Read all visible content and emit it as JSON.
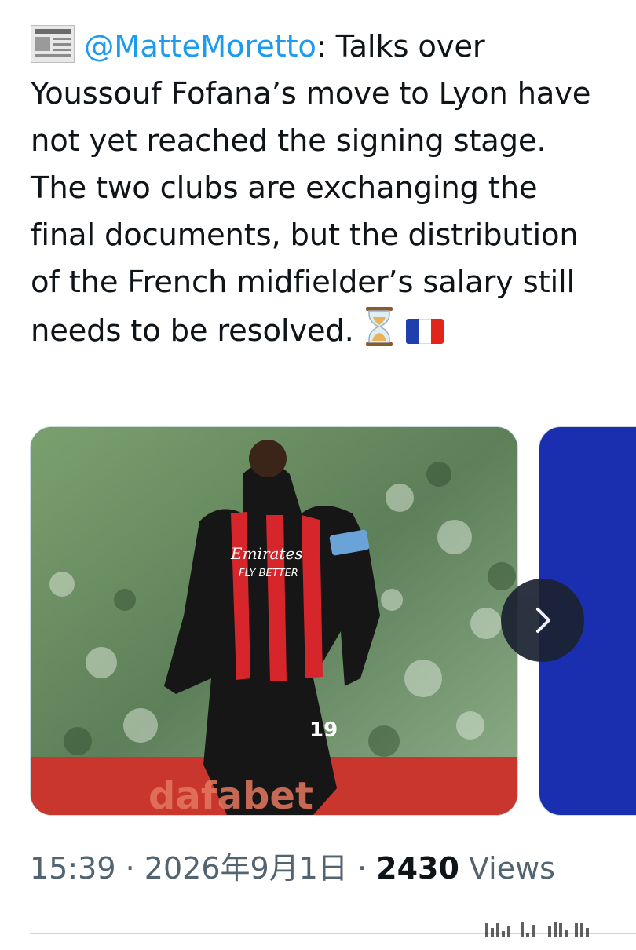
{
  "tweet": {
    "mention": "@MatteMoretto",
    "text_after_mention": ": Talks over Youssouf Fofana’s move to Lyon have not yet reached the signing stage. The two clubs are exchanging the final documents, but the distribution of the French midfielder’s salary still needs to be resolved.",
    "prefix_icon": "newspaper-icon",
    "trailing_emojis": [
      "hourglass-icon",
      "france-flag-icon"
    ]
  },
  "media": {
    "image_1_text": {
      "sponsor": "Emirates",
      "sponsor_tagline": "FLY BETTER",
      "shirt_number": "19",
      "board_text": "dafabet"
    },
    "next_button_icon": "chevron-right-icon"
  },
  "meta": {
    "time": "15:39",
    "separator": "·",
    "date": "2026年9月1日",
    "views_count": "2430",
    "views_label": "Views"
  },
  "colors": {
    "text": "#0f1419",
    "mention": "#1d9bf0",
    "secondary": "#536471",
    "jersey_red": "#d7262b",
    "jersey_black": "#161616",
    "second_card_blue": "#1a2fb0"
  }
}
